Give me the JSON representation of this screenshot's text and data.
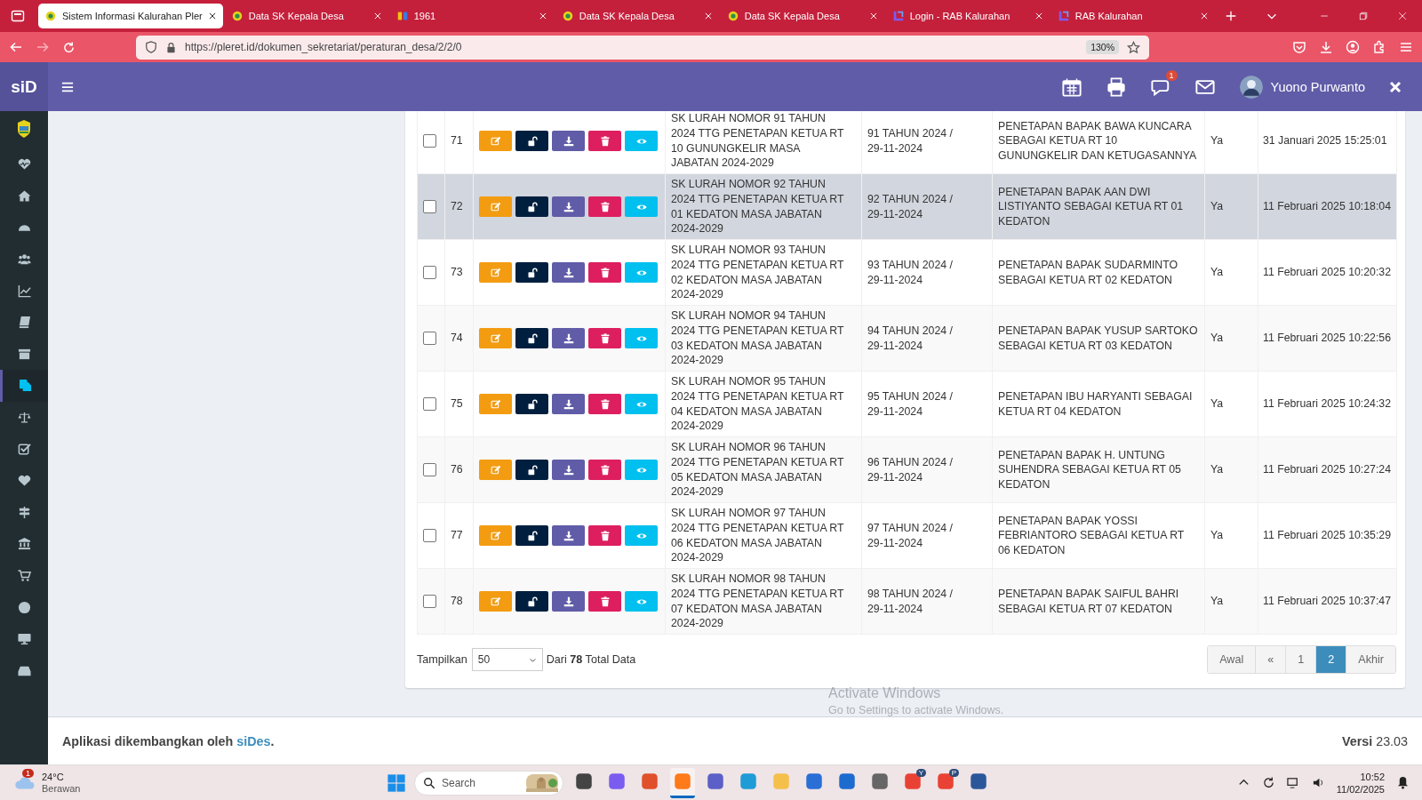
{
  "browser": {
    "tabs": [
      {
        "title": "Sistem Informasi Kalurahan Pler",
        "selected": true
      },
      {
        "title": "Data SK Kepala Desa",
        "selected": false
      },
      {
        "title": "1961",
        "selected": false
      },
      {
        "title": "Data SK Kepala Desa",
        "selected": false
      },
      {
        "title": "Data SK Kepala Desa",
        "selected": false
      },
      {
        "title": "Login - RAB Kalurahan",
        "selected": false
      },
      {
        "title": "RAB Kalurahan",
        "selected": false
      }
    ],
    "url": "https://pleret.id/dokumen_sekretariat/peraturan_desa/2/2/0",
    "zoom": "130%"
  },
  "header": {
    "brand": "siD",
    "notification_count": "1",
    "user": "Yuono Purwanto"
  },
  "sidebar": {
    "items": [
      {
        "selected": false
      },
      {
        "selected": false
      },
      {
        "selected": false
      },
      {
        "selected": false
      },
      {
        "selected": false
      },
      {
        "selected": false
      },
      {
        "selected": false
      },
      {
        "selected": true
      },
      {
        "selected": false
      },
      {
        "selected": false
      },
      {
        "selected": false
      },
      {
        "selected": false
      },
      {
        "selected": false
      },
      {
        "selected": false
      },
      {
        "selected": false
      },
      {
        "selected": false
      },
      {
        "selected": false
      }
    ]
  },
  "table": {
    "rows": [
      {
        "checked": false,
        "selected": false,
        "number": "71",
        "name": "SK LURAH NOMOR 91 TAHUN 2024 TTG PENETAPAN KETUA RT 10 GUNUNGKELIR MASA JABATAN 2024-2029",
        "nomor": "91 TAHUN 2024 / 29-11-2024",
        "uraian": "PENETAPAN BAPAK BAWA KUNCARA SEBAGAI KETUA RT 10 GUNUNGKELIR DAN KETUGASANNYA",
        "status": "Ya",
        "timestamp": "31 Januari 2025 15:25:01"
      },
      {
        "checked": false,
        "selected": true,
        "number": "72",
        "name": "SK LURAH NOMOR 92 TAHUN 2024 TTG PENETAPAN KETUA RT 01 KEDATON MASA JABATAN 2024-2029",
        "nomor": "92 TAHUN 2024 / 29-11-2024",
        "uraian": "PENETAPAN BAPAK AAN DWI LISTIYANTO SEBAGAI KETUA RT 01 KEDATON",
        "status": "Ya",
        "timestamp": "11 Februari 2025 10:18:04"
      },
      {
        "checked": false,
        "selected": false,
        "number": "73",
        "name": "SK LURAH NOMOR 93 TAHUN 2024 TTG PENETAPAN KETUA RT 02 KEDATON MASA JABATAN 2024-2029",
        "nomor": "93 TAHUN 2024 / 29-11-2024",
        "uraian": "PENETAPAN BAPAK SUDARMINTO SEBAGAI KETUA RT 02 KEDATON",
        "status": "Ya",
        "timestamp": "11 Februari 2025 10:20:32"
      },
      {
        "checked": false,
        "selected": false,
        "number": "74",
        "name": "SK LURAH NOMOR 94 TAHUN 2024 TTG PENETAPAN KETUA RT 03 KEDATON MASA JABATAN 2024-2029",
        "nomor": "94 TAHUN 2024 / 29-11-2024",
        "uraian": "PENETAPAN BAPAK YUSUP SARTOKO SEBAGAI KETUA RT 03 KEDATON",
        "status": "Ya",
        "timestamp": "11 Februari 2025 10:22:56"
      },
      {
        "checked": false,
        "selected": false,
        "number": "75",
        "name": "SK LURAH NOMOR 95 TAHUN 2024 TTG PENETAPAN KETUA RT 04 KEDATON MASA JABATAN 2024-2029",
        "nomor": "95 TAHUN 2024 / 29-11-2024",
        "uraian": "PENETAPAN IBU HARYANTI SEBAGAI KETUA RT 04 KEDATON",
        "status": "Ya",
        "timestamp": "11 Februari 2025 10:24:32"
      },
      {
        "checked": false,
        "selected": false,
        "number": "76",
        "name": "SK LURAH NOMOR 96 TAHUN 2024 TTG PENETAPAN KETUA RT 05 KEDATON MASA JABATAN 2024-2029",
        "nomor": "96 TAHUN 2024 / 29-11-2024",
        "uraian": "PENETAPAN BAPAK H. UNTUNG SUHENDRA SEBAGAI KETUA RT 05 KEDATON",
        "status": "Ya",
        "timestamp": "11 Februari 2025 10:27:24"
      },
      {
        "checked": false,
        "selected": false,
        "number": "77",
        "name": "SK LURAH NOMOR 97 TAHUN 2024 TTG PENETAPAN KETUA RT 06 KEDATON MASA JABATAN 2024-2029",
        "nomor": "97 TAHUN 2024 / 29-11-2024",
        "uraian": "PENETAPAN BAPAK YOSSI FEBRIANTORO SEBAGAI KETUA RT 06 KEDATON",
        "status": "Ya",
        "timestamp": "11 Februari 2025 10:35:29"
      },
      {
        "checked": false,
        "selected": false,
        "number": "78",
        "name": "SK LURAH NOMOR 98 TAHUN 2024 TTG PENETAPAN KETUA RT 07 KEDATON MASA JABATAN 2024-2029",
        "nomor": "98 TAHUN 2024 / 29-11-2024",
        "uraian": "PENETAPAN BAPAK SAIFUL BAHRI SEBAGAI KETUA RT 07 KEDATON",
        "status": "Ya",
        "timestamp": "11 Februari 2025 10:37:47"
      }
    ]
  },
  "pagination": {
    "show_label": "Tampilkan",
    "page_size": "50",
    "total": "Dari **78** Total Data",
    "pages": [
      {
        "label": "Awal",
        "selected": false
      },
      {
        "label": "«",
        "selected": false
      },
      {
        "label": "1",
        "selected": false
      },
      {
        "label": "2",
        "selected": true
      },
      {
        "label": "Akhir",
        "selected": false
      }
    ]
  },
  "footer": {
    "credit": "Aplikasi dikembangkan oleh",
    "credit_link": "siDes",
    "credit_end": ".",
    "version": "**Versi** 23.03"
  },
  "os_notice": {
    "title": "Activate Windows",
    "text": "Go to Settings to activate Windows."
  },
  "taskbar": {
    "weather_badge": "1",
    "temperature": "24°C",
    "condition": "Berawan",
    "search_placeholder": "Search",
    "apps": [
      {
        "active": false
      },
      {
        "active": false
      },
      {
        "active": false
      },
      {
        "active": true
      },
      {
        "active": false
      },
      {
        "active": false
      },
      {
        "active": false
      },
      {
        "active": false
      },
      {
        "active": false
      },
      {
        "active": false
      },
      {
        "active": false,
        "badge": "Y"
      },
      {
        "active": false,
        "badge": "P"
      },
      {
        "active": false
      }
    ],
    "time": "10:52",
    "date": "11/02/2025"
  }
}
